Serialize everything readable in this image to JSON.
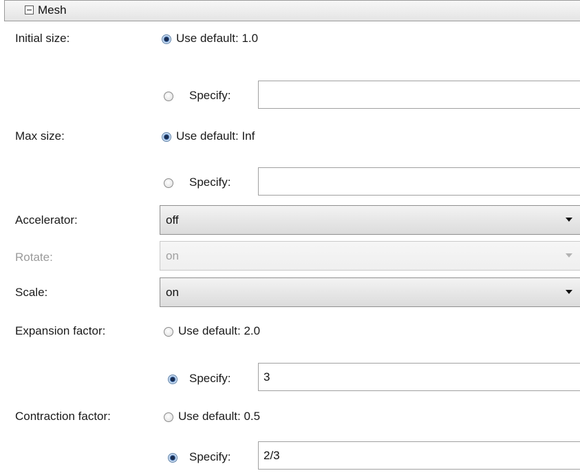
{
  "section": {
    "title": "Mesh"
  },
  "initial_size": {
    "label": "Initial size:",
    "use_default": {
      "label": "Use default: 1.0",
      "selected": true
    },
    "specify": {
      "label": "Specify:",
      "value": "",
      "selected": false
    }
  },
  "max_size": {
    "label": "Max size:",
    "use_default": {
      "label": "Use default: Inf",
      "selected": true
    },
    "specify": {
      "label": "Specify:",
      "value": "",
      "selected": false
    }
  },
  "accelerator": {
    "label": "Accelerator:",
    "value": "off"
  },
  "rotate": {
    "label": "Rotate:",
    "value": "on",
    "disabled": true
  },
  "scale": {
    "label": "Scale:",
    "value": "on"
  },
  "expansion_factor": {
    "label": "Expansion factor:",
    "use_default": {
      "label": "Use default: 2.0",
      "selected": false
    },
    "specify": {
      "label": "Specify:",
      "value": "3",
      "selected": true
    }
  },
  "contraction_factor": {
    "label": "Contraction factor:",
    "use_default": {
      "label": "Use default: 0.5",
      "selected": false
    },
    "specify": {
      "label": "Specify:",
      "value": "2/3",
      "selected": true
    }
  }
}
